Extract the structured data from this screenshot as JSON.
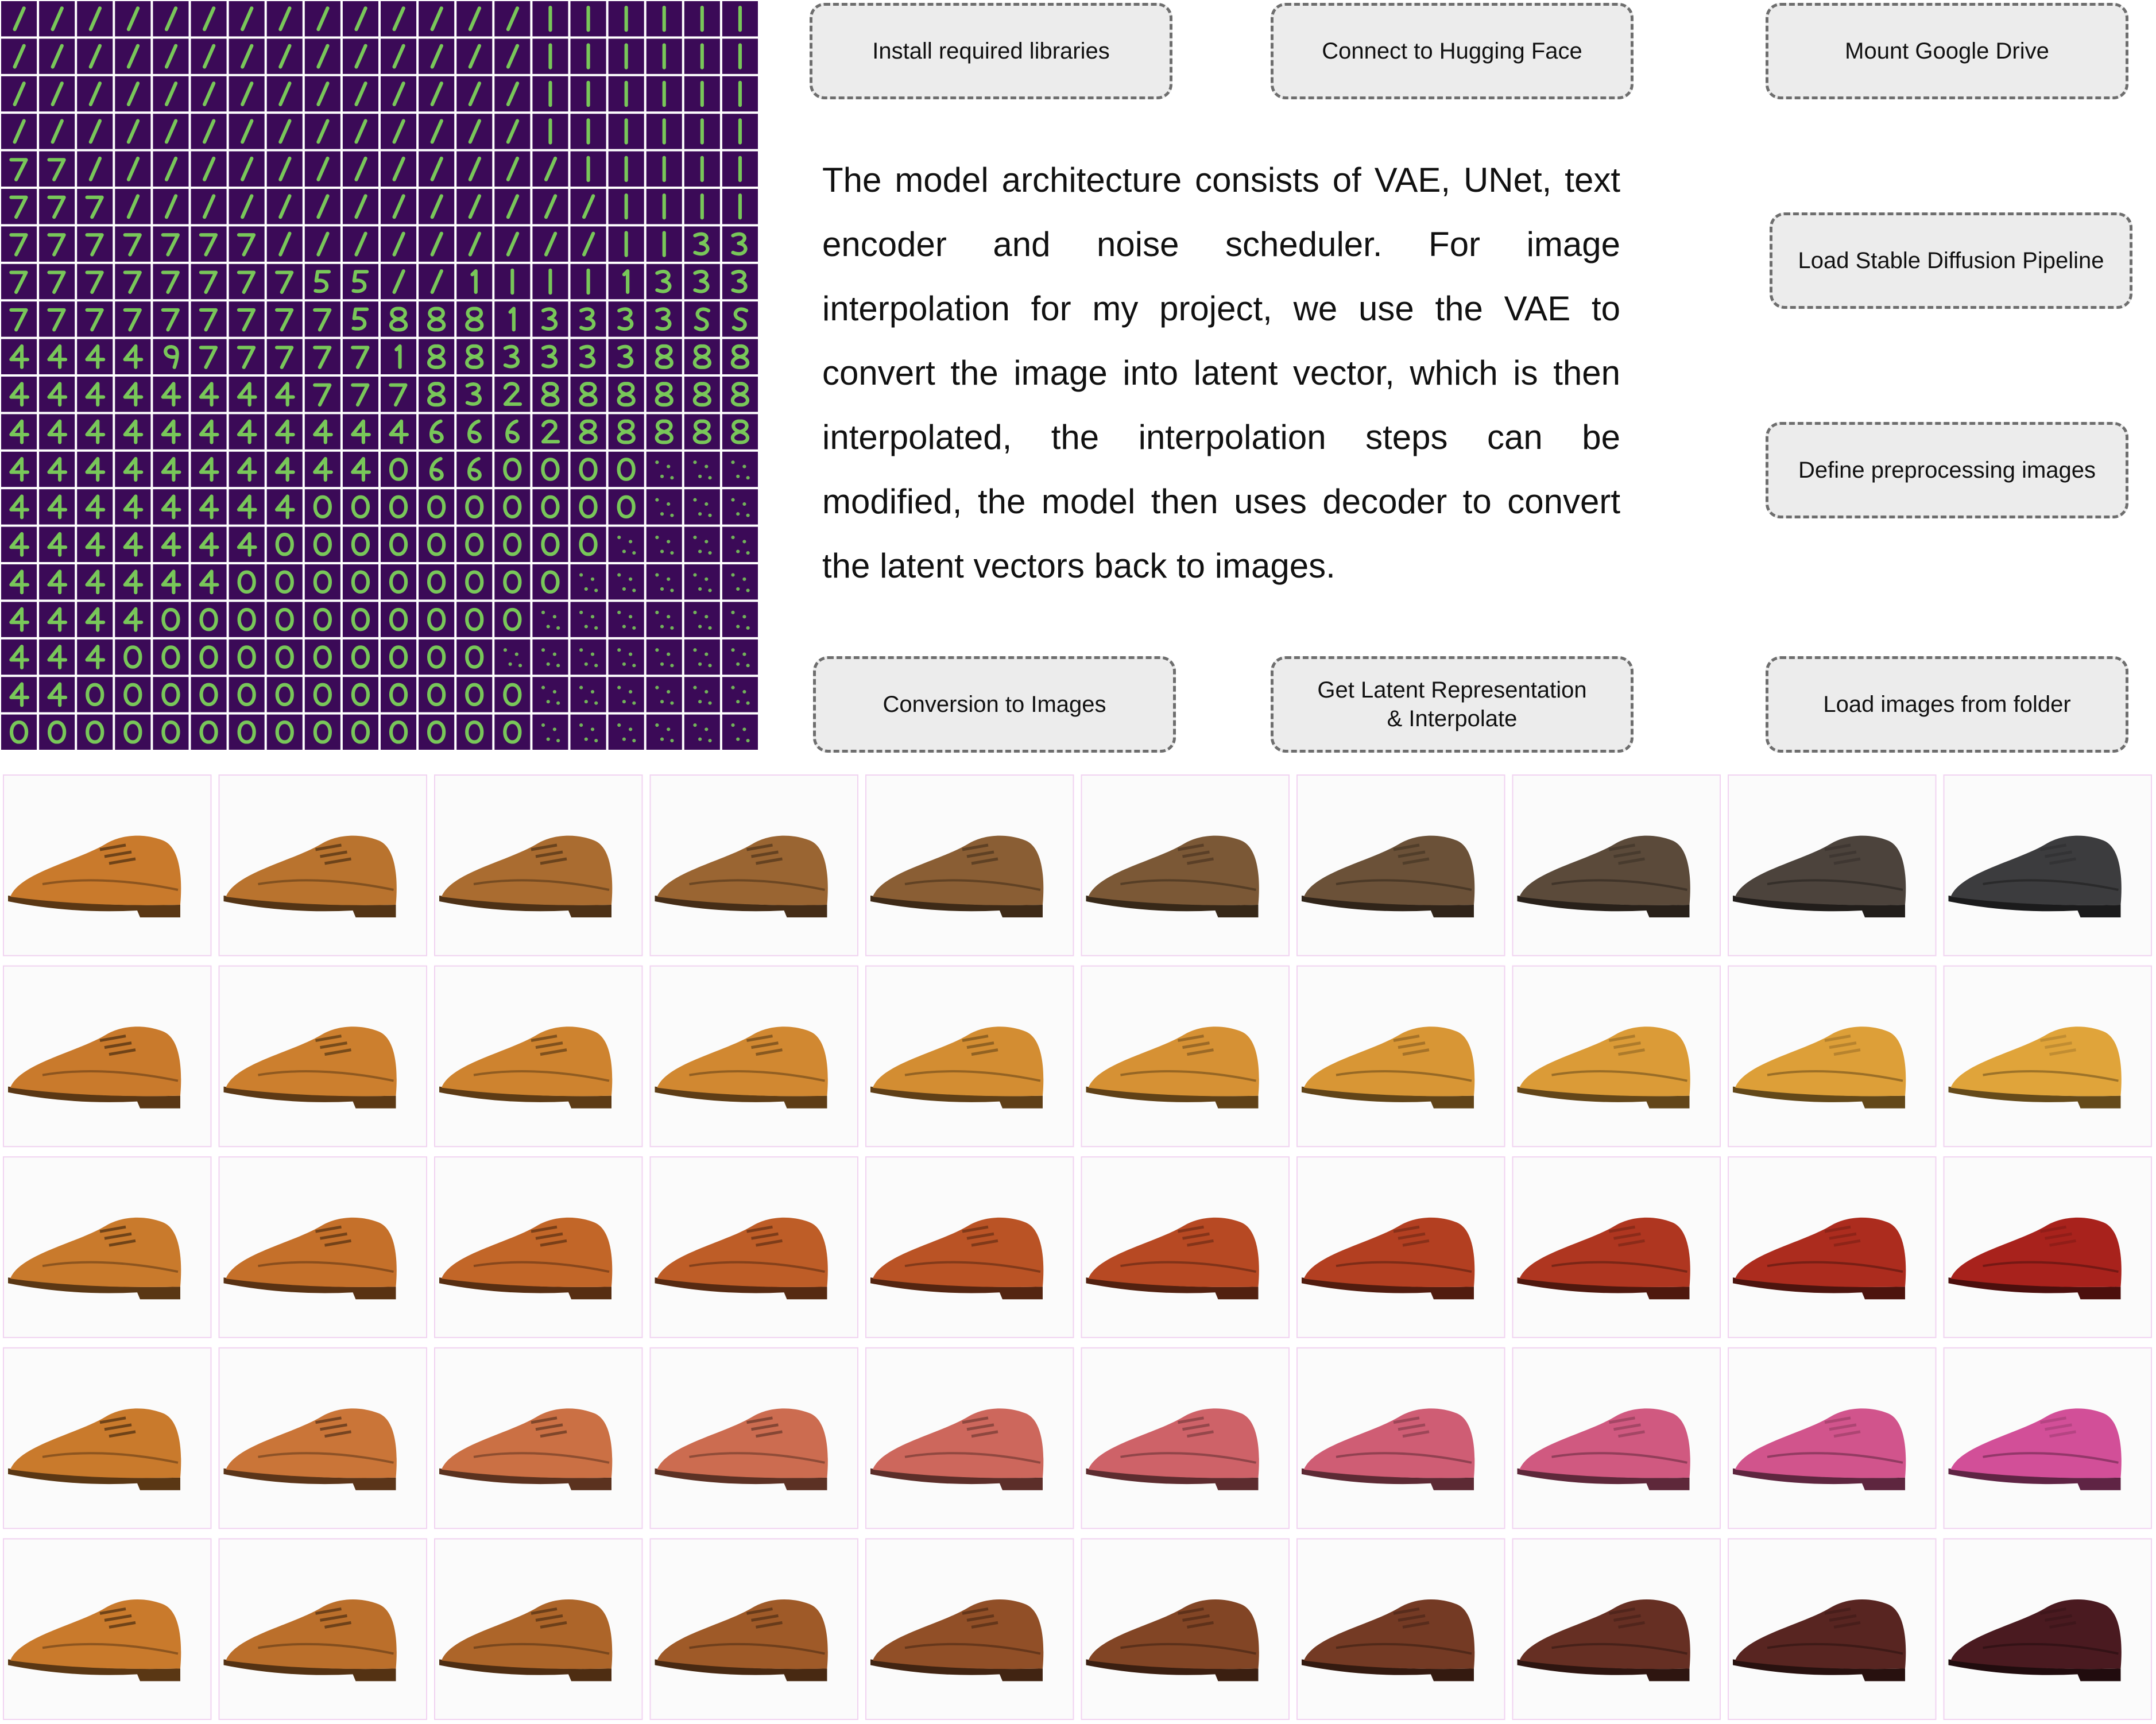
{
  "pipeline": {
    "steps": [
      {
        "label": "Install required libraries"
      },
      {
        "label": "Connect to Hugging Face"
      },
      {
        "label": "Mount Google Drive"
      },
      {
        "label": "Load Stable Diffusion Pipeline"
      },
      {
        "label": "Define preprocessing images"
      },
      {
        "label": "Load images from folder"
      },
      {
        "label": "Get Latent Representation\n& Interpolate"
      },
      {
        "label": "Conversion to Images"
      }
    ]
  },
  "description": "The model architecture consists of VAE, UNet, text encoder and noise scheduler. For image interpolation for my project, we use the VAE to convert the image into latent vector, which is then interpolated, the interpolation steps can be modified, the model then uses decoder to convert the latent vectors back to images.",
  "mnist_grid": {
    "rows": 20,
    "cols": 20,
    "background_color": "#3b0a57",
    "stroke_color": "#7fdc5a",
    "digits": [
      "//////////////||||||",
      "//////////////||||||",
      "//////////////||||||",
      "//////////////||||||",
      "77/////////////|||||",
      "777/////////////||||",
      "7777777/////////||33",
      "7777777755//1|||1333",
      "777777777588813333SS",
      "44449777771883333888",
      "44444444777832888888",
      "44444444444666288888",
      "44444444440660000:::",
      "44444444000000000:::",
      "4444444000000000::::",
      "444444000000000:::::",
      "44440000000000::::::",
      "4440000000000:::::::",
      "44000000000000::::::",
      "00000000000000::::::"
    ]
  },
  "shoe_grid": {
    "rows": 5,
    "cols": 10,
    "start_color": "#c97a2c",
    "end_colors": [
      "#3c3c3e",
      "#e0a43a",
      "#a8221c",
      "#d24f98",
      "#4a1a20"
    ]
  }
}
